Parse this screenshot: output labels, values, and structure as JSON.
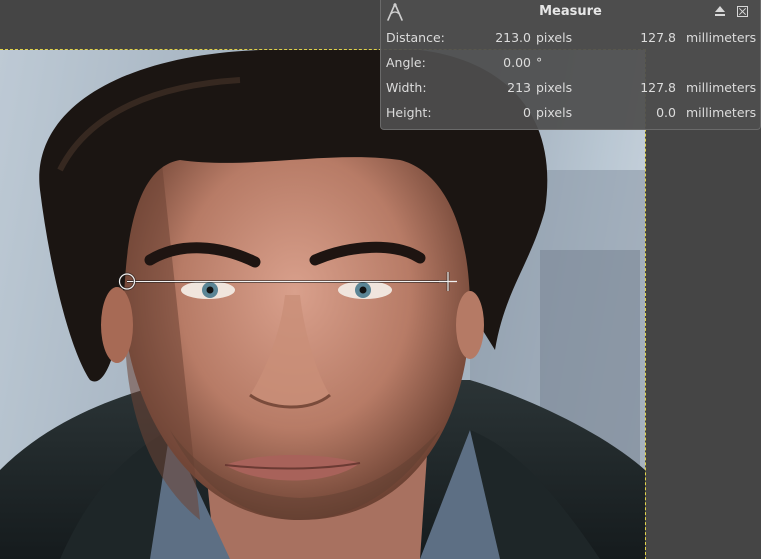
{
  "panel": {
    "title": "Measure",
    "icons": {
      "tool": "measure-tool-icon",
      "detach": "detach-icon",
      "close": "close-icon"
    }
  },
  "rows": [
    {
      "label": "Distance:",
      "value": "213.0",
      "unit": "pixels",
      "value2": "127.8",
      "unit2": "millimeters"
    },
    {
      "label": "Angle:",
      "value": "0.00",
      "unit": "°",
      "value2": "",
      "unit2": ""
    },
    {
      "label": "Width:",
      "value": "213",
      "unit": "pixels",
      "value2": "127.8",
      "unit2": "millimeters"
    },
    {
      "label": "Height:",
      "value": "0",
      "unit": "pixels",
      "value2": "0.0",
      "unit2": "millimeters"
    }
  ],
  "colors": {
    "canvas_bg": "#454545",
    "panel_bg": "#4e4e4e",
    "panel_text": "#dcdcdc",
    "layer_boundary": "#e0d34a",
    "measure_line": "#f0f0f0"
  }
}
